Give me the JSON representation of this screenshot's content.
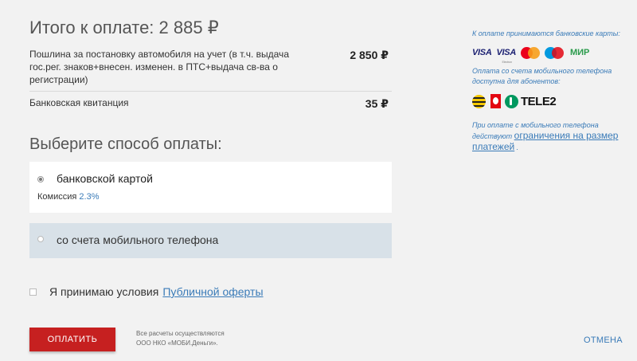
{
  "summary": {
    "total": "Итого к оплате: 2 885 ₽",
    "items": [
      {
        "description": "Пошлина за постановку автомобиля на учет (в т.ч. выдача гос.рег. знаков+внесен. изменен. в ПТС+выдача св-ва о регистрации)",
        "price": "2 850 ₽"
      },
      {
        "description": "Банковская квитанция",
        "price": "35 ₽"
      }
    ]
  },
  "payment": {
    "title": "Выберите способ оплаты:",
    "methods": [
      {
        "label": "банковской картой",
        "selected": true,
        "commission_label": "Комиссия",
        "commission_rate": "2.3%"
      },
      {
        "label": "со счета мобильного телефона",
        "selected": false
      }
    ]
  },
  "terms": {
    "text": "Я принимаю условия",
    "link": "Публичной оферты",
    "checked": false
  },
  "footer": {
    "pay_button": "ОПЛАТИТЬ",
    "disclaimer_line1": "Все расчеты осуществляются",
    "disclaimer_line2": "ООО НКО «МОБИ.Деньги».",
    "cancel": "ОТМЕНА"
  },
  "sidebar": {
    "cards_text": "К оплате принимаются банковские карты:",
    "card_logos": [
      "VISA",
      "VISA",
      "mastercard",
      "maestro",
      "МИР"
    ],
    "card_logo_small": "Electron",
    "mobile_text": "Оплата со счета мобильного телефона доступна для абонентов:",
    "operator_logos": [
      "beeline-icon",
      "mts-icon",
      "megafon-icon",
      "TELE2"
    ],
    "limits_text": "При оплате с мобильного телефона действуют",
    "limits_link": "ограничения на размер платежей",
    "limits_end": "."
  },
  "colors": {
    "accent": "#3a7bb8",
    "pay_button": "#c62020",
    "mobile_row": "#d8e1e8"
  }
}
